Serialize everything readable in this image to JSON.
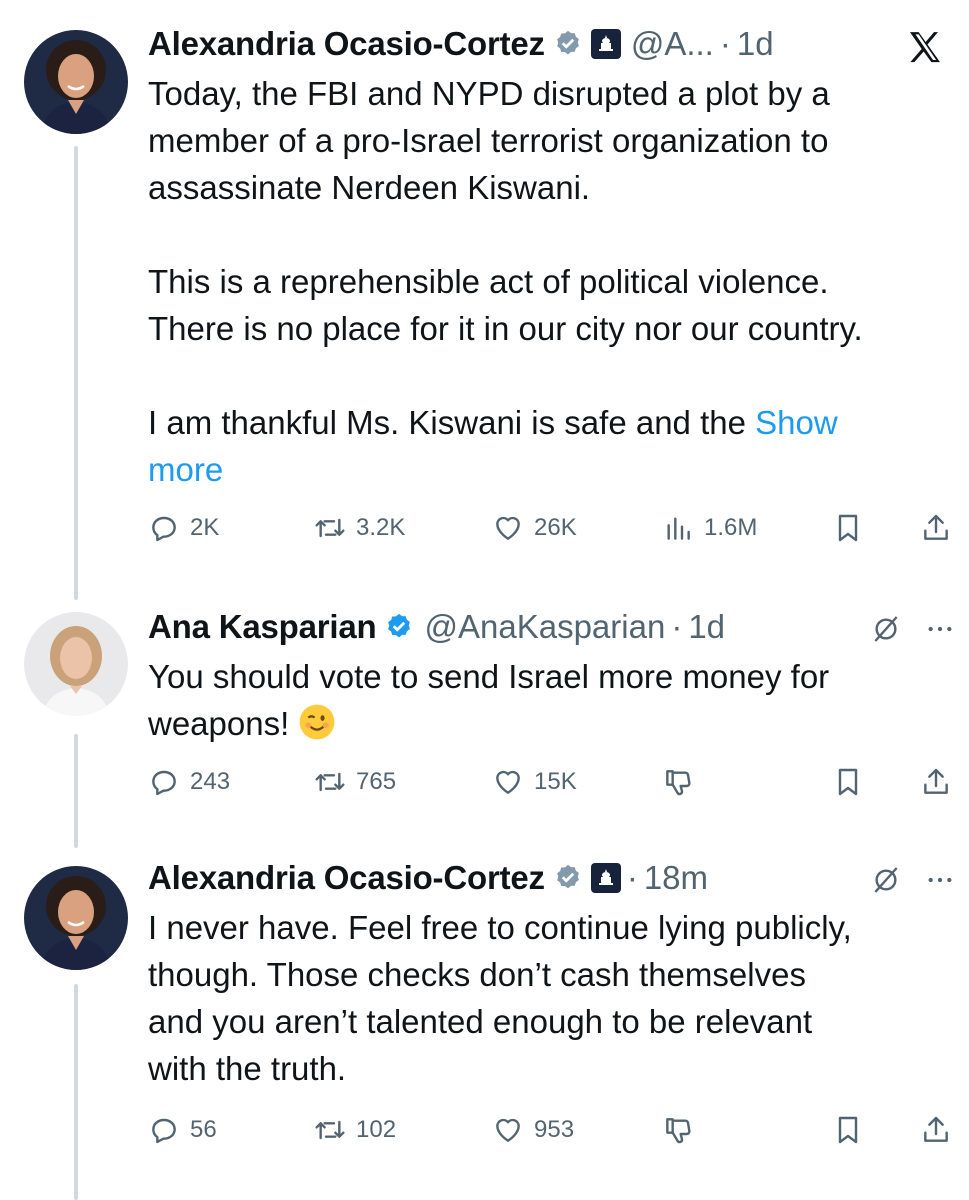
{
  "tweets": [
    {
      "name": "Alexandria Ocasio-Cortez",
      "handle": "@A...",
      "dot": "·",
      "time": "1d",
      "body": "Today, the FBI and NYPD disrupted a plot by a\nmember of a pro-Israel terrorist organization to\nassassinate Nerdeen Kiswani.\n\nThis is a reprehensible act of political violence.\nThere is no place for it in our city nor our country.\n\nI am thankful Ms. Kiswani is safe and the ",
      "show_more_1": "Show",
      "show_more_2": "more",
      "replies": "2K",
      "retweets": "3.2K",
      "likes": "26K",
      "views": "1.6M"
    },
    {
      "name": "Ana Kasparian",
      "handle": "@AnaKasparian",
      "dot": "·",
      "time": "1d",
      "body": "You should vote to send Israel more money for\nweapons! ",
      "replies": "243",
      "retweets": "765",
      "likes": "15K"
    },
    {
      "name": "Alexandria Ocasio-Cortez",
      "dot": "·",
      "time": "18m",
      "body": "I never have. Feel free to continue lying publicly,\nthough. Those checks don’t cash themselves\nand you aren’t talented enough to be relevant\nwith the truth.",
      "replies": "56",
      "retweets": "102",
      "likes": "953"
    }
  ],
  "colors": {
    "accent": "#1d9bf0",
    "muted": "#536471",
    "line": "#cfd9de"
  },
  "icons": [
    "x-logo-icon",
    "verified-badge-icon",
    "government-badge-icon",
    "reply-icon",
    "retweet-icon",
    "like-icon",
    "views-icon",
    "bookmark-icon",
    "share-icon",
    "grok-icon",
    "more-icon",
    "dislike-icon",
    "winking-face-emoji"
  ]
}
